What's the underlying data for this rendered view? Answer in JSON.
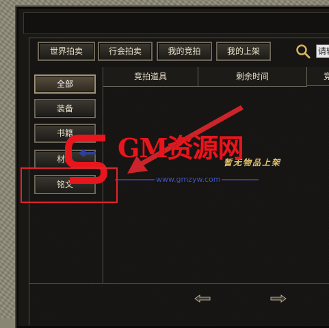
{
  "tabs": [
    {
      "label": "世界拍卖"
    },
    {
      "label": "行会拍卖"
    },
    {
      "label": "我的竞拍"
    },
    {
      "label": "我的上架"
    }
  ],
  "search": {
    "placeholder": "请输"
  },
  "categories": [
    {
      "label": "全部",
      "active": true
    },
    {
      "label": "装备"
    },
    {
      "label": "书籍"
    },
    {
      "label": "材料"
    },
    {
      "label": "铭文"
    }
  ],
  "table": {
    "columns": [
      "竞拍道具",
      "剩余时间",
      "竞"
    ]
  },
  "empty_message": "暂无物品上架",
  "watermark": {
    "text": "GM资源网",
    "url": "www.gmzyw.com"
  },
  "colors": {
    "accent_gold": "#e7c46a",
    "watermark_red": "#e8151d",
    "watermark_blue": "#2e3f9e"
  },
  "icons": {
    "search": "search-icon",
    "prev": "left-arrow-icon",
    "next": "right-arrow-icon"
  }
}
